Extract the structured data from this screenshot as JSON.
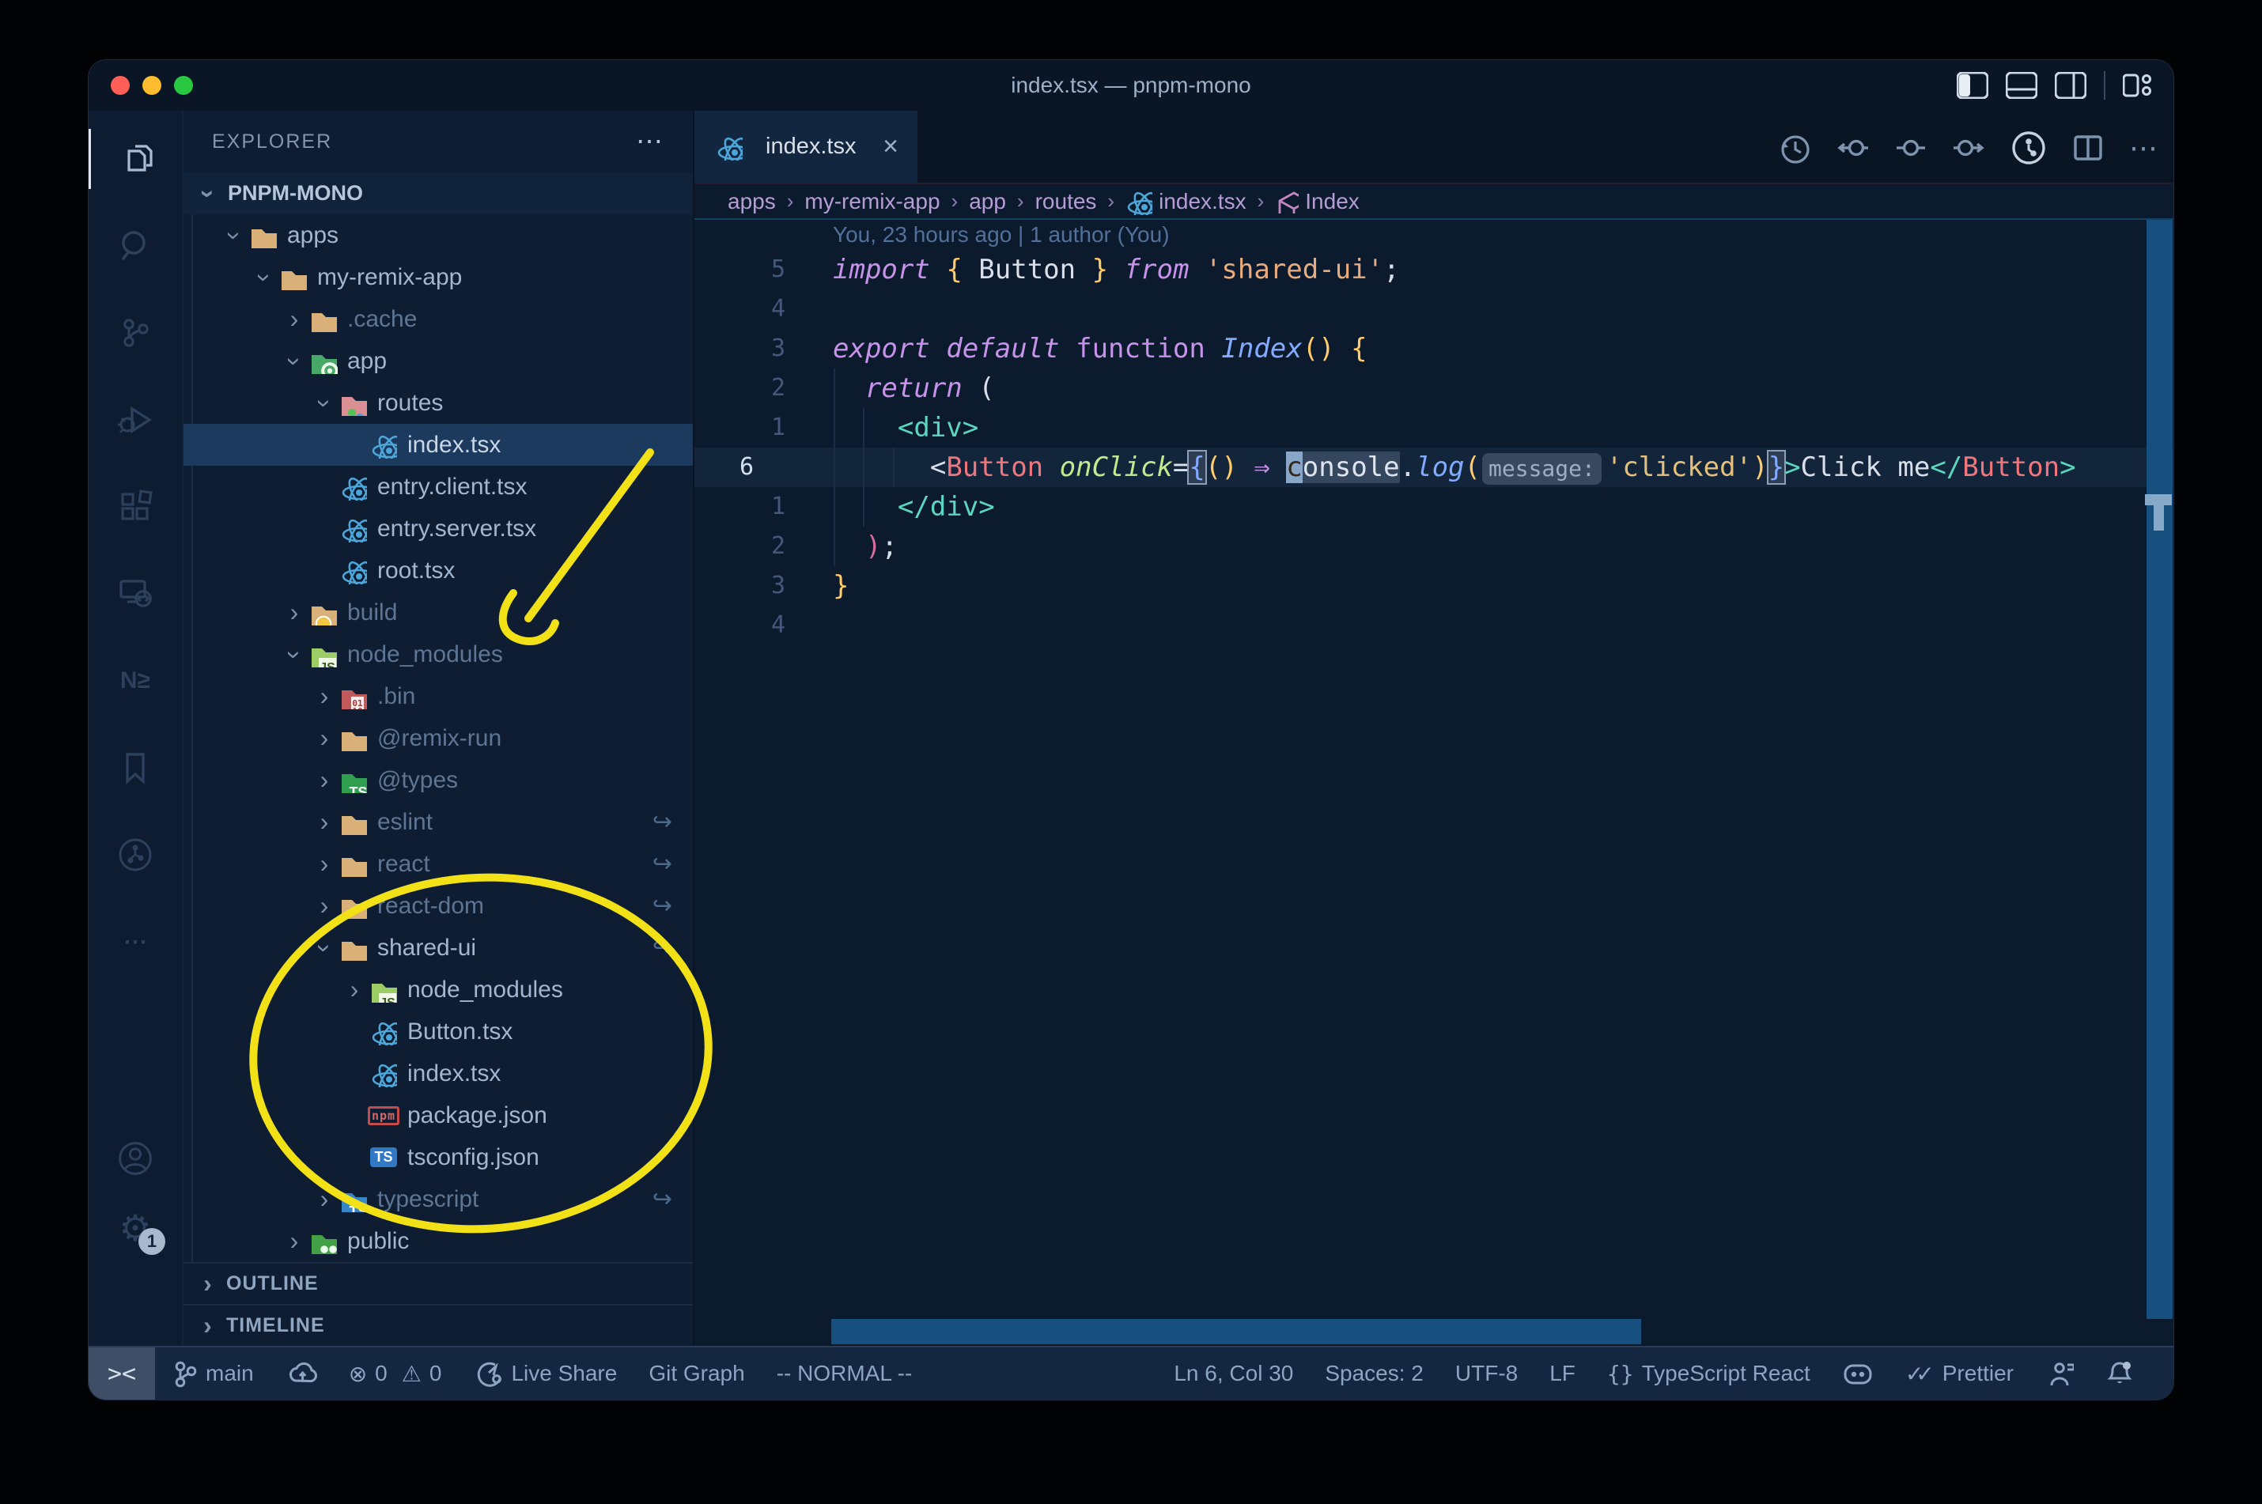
{
  "window": {
    "title": "index.tsx — pnpm-mono"
  },
  "colors": {
    "accent_yellow": "#f3e118",
    "scrollbar_blue": "#17507e",
    "traffic": [
      "#ff5f57",
      "#febc2e",
      "#28c840"
    ]
  },
  "activity_bar": {
    "top": [
      {
        "name": "explorer",
        "active": true
      },
      {
        "name": "search"
      },
      {
        "name": "source-control"
      },
      {
        "name": "run-debug"
      },
      {
        "name": "extensions"
      },
      {
        "name": "remote-explorer"
      },
      {
        "name": "nx-console",
        "text": "N≥"
      },
      {
        "name": "bookmarks"
      },
      {
        "name": "git-graph"
      },
      {
        "name": "more",
        "text": "⋯"
      }
    ],
    "bottom": [
      {
        "name": "account"
      },
      {
        "name": "settings",
        "badge": "1"
      }
    ]
  },
  "sidebar": {
    "header": "EXPLORER",
    "header_more": "⋯",
    "root": "PNPM-MONO",
    "tree": [
      {
        "label": "apps",
        "level": 1,
        "icon": "folder",
        "open": true
      },
      {
        "label": "my-remix-app",
        "level": 2,
        "icon": "folder",
        "open": true
      },
      {
        "label": ".cache",
        "level": 3,
        "icon": "folder",
        "dim": true
      },
      {
        "label": "app",
        "level": 3,
        "icon": "folder-app",
        "open": true
      },
      {
        "label": "routes",
        "level": 4,
        "icon": "folder-routes",
        "open": true
      },
      {
        "label": "index.tsx",
        "level": 5,
        "icon": "react",
        "file": true,
        "selected": true
      },
      {
        "label": "entry.client.tsx",
        "level": 4,
        "icon": "react",
        "file": true
      },
      {
        "label": "entry.server.tsx",
        "level": 4,
        "icon": "react",
        "file": true
      },
      {
        "label": "root.tsx",
        "level": 4,
        "icon": "react",
        "file": true
      },
      {
        "label": "build",
        "level": 3,
        "icon": "folder-build",
        "dim": true
      },
      {
        "label": "node_modules",
        "level": 3,
        "icon": "folder-node",
        "open": true,
        "dim": true
      },
      {
        "label": ".bin",
        "level": 4,
        "icon": "folder-bin",
        "dim": true
      },
      {
        "label": "@remix-run",
        "level": 4,
        "icon": "folder",
        "dim": true
      },
      {
        "label": "@types",
        "level": 4,
        "icon": "folder-types",
        "dim": true
      },
      {
        "label": "eslint",
        "level": 4,
        "icon": "folder",
        "dim": true,
        "link": true
      },
      {
        "label": "react",
        "level": 4,
        "icon": "folder",
        "dim": true,
        "link": true
      },
      {
        "label": "react-dom",
        "level": 4,
        "icon": "folder",
        "dim": true,
        "link": true
      },
      {
        "label": "shared-ui",
        "level": 4,
        "icon": "folder",
        "open": true,
        "link": true
      },
      {
        "label": "node_modules",
        "level": 5,
        "icon": "folder-node"
      },
      {
        "label": "Button.tsx",
        "level": 5,
        "icon": "react",
        "file": true
      },
      {
        "label": "index.tsx",
        "level": 5,
        "icon": "react",
        "file": true
      },
      {
        "label": "package.json",
        "level": 5,
        "icon": "npm",
        "file": true
      },
      {
        "label": "tsconfig.json",
        "level": 5,
        "icon": "tsconfig",
        "file": true
      },
      {
        "label": "typescript",
        "level": 4,
        "icon": "folder-ts",
        "dim": true,
        "link": true
      },
      {
        "label": "public",
        "level": 3,
        "icon": "folder-public"
      }
    ],
    "sections": [
      "OUTLINE",
      "TIMELINE"
    ],
    "link_glyph": "↪"
  },
  "editor": {
    "tab": {
      "label": "index.tsx",
      "close": "×"
    },
    "actions": [
      "history",
      "prev-change",
      "change",
      "next-change",
      "git-commit",
      "split",
      "more"
    ],
    "breadcrumbs": [
      {
        "label": "apps"
      },
      {
        "label": "my-remix-app"
      },
      {
        "label": "app"
      },
      {
        "label": "routes"
      },
      {
        "label": "index.tsx",
        "icon": "react"
      },
      {
        "label": "Index",
        "icon": "symbol"
      }
    ],
    "breadcrumb_sep": "›",
    "blame": "You, 23 hours ago | 1 author (You)",
    "code": {
      "lines": [
        {
          "num": "5",
          "g": 0,
          "tokens": [
            {
              "t": "import",
              "s": "kw"
            },
            {
              "t": " "
            },
            {
              "t": "{",
              "s": "by"
            },
            {
              "t": " "
            },
            {
              "t": "Button",
              "s": "w"
            },
            {
              "t": " "
            },
            {
              "t": "}",
              "s": "by"
            },
            {
              "t": " "
            },
            {
              "t": "from",
              "s": "kw"
            },
            {
              "t": " "
            },
            {
              "t": "'shared-ui'",
              "s": "str2"
            },
            {
              "t": ";",
              "s": "w"
            }
          ]
        },
        {
          "num": "4",
          "g": 0,
          "tokens": []
        },
        {
          "num": "3",
          "g": 0,
          "tokens": [
            {
              "t": "export",
              "s": "kw"
            },
            {
              "t": " "
            },
            {
              "t": "default",
              "s": "kw"
            },
            {
              "t": " "
            },
            {
              "t": "function",
              "s": "kwr"
            },
            {
              "t": " "
            },
            {
              "t": "Index",
              "s": "fn"
            },
            {
              "t": "()",
              "s": "by"
            },
            {
              "t": " "
            },
            {
              "t": "{",
              "s": "by"
            }
          ]
        },
        {
          "num": "2",
          "g": 1,
          "tokens": [
            {
              "t": "  "
            },
            {
              "t": "return",
              "s": "kw"
            },
            {
              "t": " "
            },
            {
              "t": "(",
              "s": "w"
            }
          ]
        },
        {
          "num": "1",
          "g": 2,
          "tokens": [
            {
              "t": "    "
            },
            {
              "t": "<div>",
              "s": "teal"
            }
          ]
        },
        {
          "num": "6",
          "g": 3,
          "current": true,
          "tokens": [
            {
              "t": "      "
            },
            {
              "t": "<",
              "s": "w"
            },
            {
              "t": "Button",
              "s": "tag"
            },
            {
              "t": " "
            },
            {
              "t": "onClick",
              "s": "attr"
            },
            {
              "t": "=",
              "s": "w"
            },
            {
              "t": "{",
              "s": "bb",
              "box": true
            },
            {
              "t": "()",
              "s": "by"
            },
            {
              "t": " "
            },
            {
              "t": "⇒",
              "s": "arrow"
            },
            {
              "t": " "
            },
            {
              "t": "c",
              "s": "cursor"
            },
            {
              "t": "onsole",
              "s": "whl"
            },
            {
              "t": ".",
              "s": "w"
            },
            {
              "t": "log",
              "s": "fn"
            },
            {
              "t": "(",
              "s": "by"
            },
            {
              "t": "message:",
              "s": "inlay"
            },
            {
              "t": "'clicked'",
              "s": "str"
            },
            {
              "t": ")",
              "s": "by"
            },
            {
              "t": "}",
              "s": "bb",
              "box": true
            },
            {
              "t": ">",
              "s": "teal"
            },
            {
              "t": "Click me",
              "s": "w"
            },
            {
              "t": "</",
              "s": "teal"
            },
            {
              "t": "Button",
              "s": "tag"
            },
            {
              "t": ">",
              "s": "teal"
            }
          ]
        },
        {
          "num": "1",
          "g": 2,
          "tokens": [
            {
              "t": "    "
            },
            {
              "t": "</div>",
              "s": "teal"
            }
          ]
        },
        {
          "num": "2",
          "g": 1,
          "tokens": [
            {
              "t": "  "
            },
            {
              "t": ")",
              "s": "bp"
            },
            {
              "t": ";",
              "s": "w"
            }
          ]
        },
        {
          "num": "3",
          "g": 0,
          "tokens": [
            {
              "t": "}",
              "s": "by"
            }
          ]
        },
        {
          "num": "4",
          "g": 0,
          "tokens": []
        }
      ]
    }
  },
  "status_bar": {
    "left": [
      {
        "name": "remote-indicator",
        "icon": "remote",
        "box": true
      },
      {
        "name": "branch",
        "icon": "branch",
        "label": "main"
      },
      {
        "name": "publish",
        "icon": "cloud"
      },
      {
        "name": "problems",
        "icon": "problems",
        "label_errors": "0",
        "label_warnings": "0"
      },
      {
        "name": "live-share",
        "icon": "share",
        "label": "Live Share"
      },
      {
        "name": "git-graph",
        "label": "Git Graph"
      },
      {
        "name": "vim-mode",
        "label": "-- NORMAL --"
      }
    ],
    "right": [
      {
        "name": "cursor-position",
        "label": "Ln 6, Col 30"
      },
      {
        "name": "indentation",
        "label": "Spaces: 2"
      },
      {
        "name": "encoding",
        "label": "UTF-8"
      },
      {
        "name": "eol",
        "label": "LF"
      },
      {
        "name": "language-mode",
        "icon": "braces",
        "label": "TypeScript React"
      },
      {
        "name": "copilot",
        "icon": "copilot"
      },
      {
        "name": "formatter",
        "icon": "checks",
        "label": "Prettier"
      },
      {
        "name": "feedback",
        "icon": "person"
      },
      {
        "name": "notifications",
        "icon": "bell"
      }
    ]
  }
}
